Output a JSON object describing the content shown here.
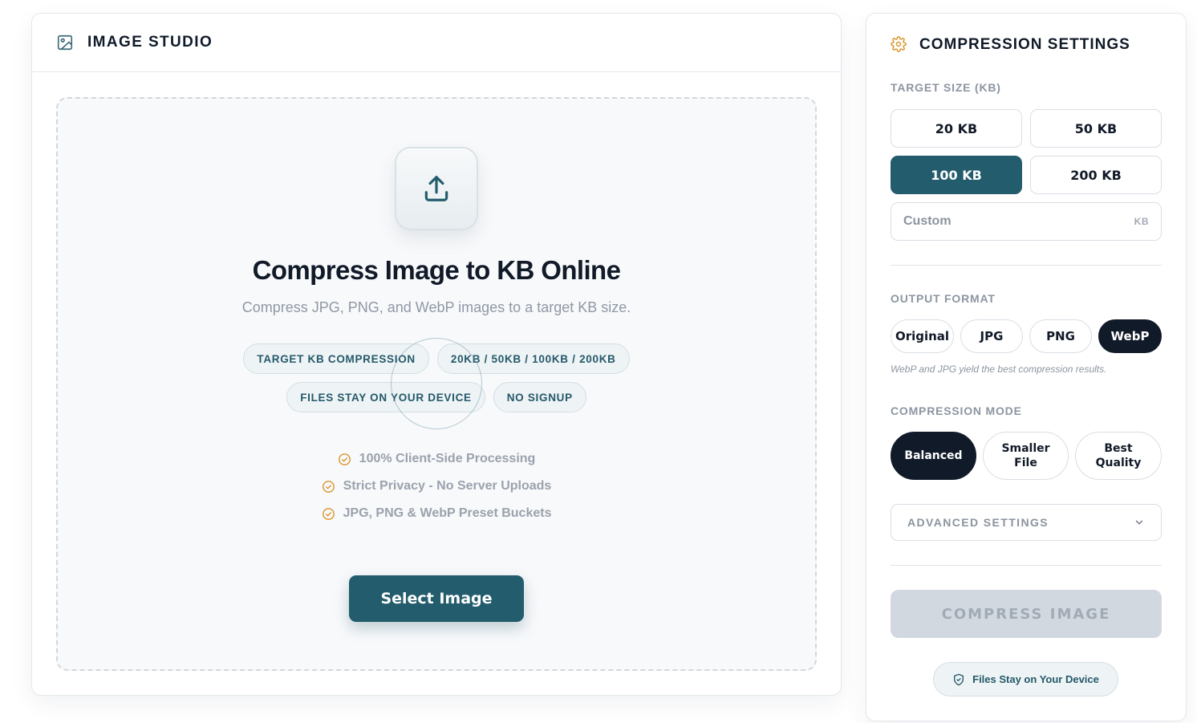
{
  "colors": {
    "primary": "#235c6d",
    "dark": "#111a28",
    "accent_orange": "#d9962f",
    "muted": "#8c95a1",
    "disabled_bg": "#d2d8df"
  },
  "studio": {
    "title": "IMAGE STUDIO",
    "header_icon": "image-icon",
    "dropzone": {
      "upload_icon": "upload-icon",
      "title": "Compress Image to KB Online",
      "subtitle": "Compress JPG, PNG, and WebP images to a target KB size.",
      "chips_row1": [
        "TARGET KB COMPRESSION",
        "20KB / 50KB / 100KB / 200KB"
      ],
      "chips_row2": [
        "FILES STAY ON YOUR DEVICE",
        "NO SIGNUP"
      ],
      "features": [
        "100% Client-Side Processing",
        "Strict Privacy - No Server Uploads",
        "JPG, PNG & WebP Preset Buckets"
      ],
      "feature_icon": "check-circle-icon",
      "select_button": "Select Image"
    }
  },
  "settings": {
    "title": "COMPRESSION SETTINGS",
    "header_icon": "gear-icon",
    "target_size": {
      "label": "TARGET SIZE (KB)",
      "options": [
        "20 KB",
        "50 KB",
        "100 KB",
        "200 KB"
      ],
      "selected": "100 KB",
      "custom_placeholder": "Custom",
      "custom_unit": "KB"
    },
    "output_format": {
      "label": "OUTPUT FORMAT",
      "options": [
        "Original",
        "JPG",
        "PNG",
        "WebP"
      ],
      "selected": "WebP",
      "hint": "WebP and JPG yield the best compression results."
    },
    "compression_mode": {
      "label": "COMPRESSION MODE",
      "options": [
        "Balanced",
        "Smaller\nFile",
        "Best\nQuality"
      ],
      "selected": "Balanced"
    },
    "advanced": {
      "label": "ADVANCED SETTINGS",
      "icon": "chevron-down-icon"
    },
    "compress_button": "COMPRESS IMAGE",
    "privacy_badge": "Files Stay on Your Device",
    "privacy_icon": "shield-check-icon"
  }
}
